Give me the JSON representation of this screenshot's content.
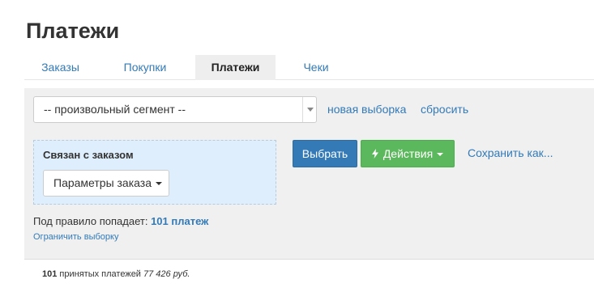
{
  "page": {
    "title": "Платежи"
  },
  "tabs": [
    {
      "label": "Заказы",
      "active": false
    },
    {
      "label": "Покупки",
      "active": false
    },
    {
      "label": "Платежи",
      "active": true
    },
    {
      "label": "Чеки",
      "active": false
    }
  ],
  "filter": {
    "segment_value": "-- произвольный сегмент --",
    "new_selection_label": "новая выборка",
    "reset_label": "сбросить",
    "condition": {
      "title": "Связан с заказом",
      "order_params_label": "Параметры заказа"
    },
    "select_button_label": "Выбрать",
    "actions_button_label": "Действия",
    "save_as_label": "Сохранить как...",
    "rule_prefix": "Под правило попадает:",
    "rule_count": "101 платеж",
    "limit_selection_label": "Ограничить выборку"
  },
  "summary": {
    "count": "101",
    "text": "принятых платежей",
    "amount": "77 426 руб."
  },
  "colors": {
    "link": "#337ab7",
    "primary": "#337ab7",
    "success": "#5cb85c",
    "panel_bg": "#f0f0f0",
    "condition_bg": "#dfeefc"
  }
}
